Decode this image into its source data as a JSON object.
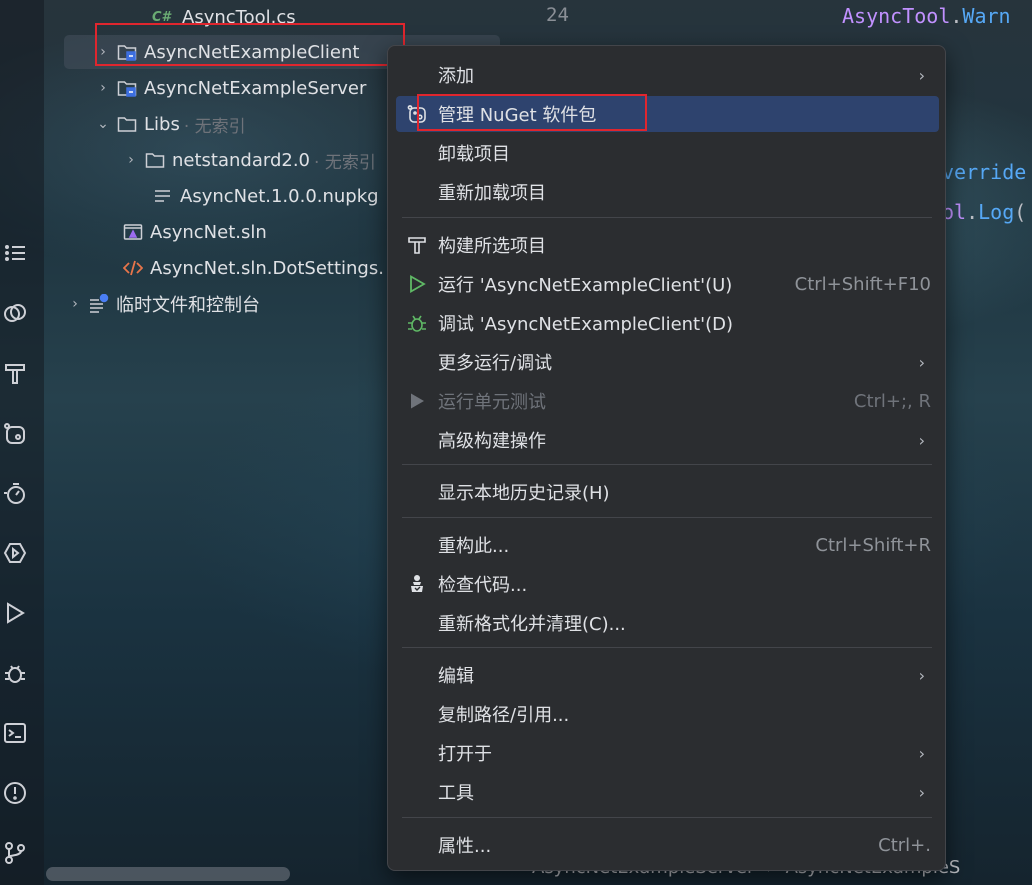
{
  "project_tree": {
    "items": [
      {
        "label": "AsyncTool.cs",
        "badge": "C#",
        "icon": "csharp-file-icon"
      },
      {
        "label": "AsyncNetExampleClient",
        "icon": "project-folder-icon",
        "expanded": false,
        "selected": true
      },
      {
        "label": "AsyncNetExampleServer",
        "icon": "project-folder-icon",
        "expanded": false
      },
      {
        "label": "Libs",
        "hint": "· 无索引",
        "icon": "folder-icon",
        "expanded": true
      },
      {
        "label": "netstandard2.0",
        "hint": "· 无索引",
        "icon": "folder-icon",
        "expanded": false
      },
      {
        "label": "AsyncNet.1.0.0.nupkg",
        "icon": "text-file-icon"
      },
      {
        "label": "AsyncNet.sln",
        "icon": "solution-file-icon"
      },
      {
        "label": "AsyncNet.sln.DotSettings.",
        "icon": "xml-file-icon"
      },
      {
        "label": "临时文件和控制台",
        "icon": "scratches-icon",
        "expanded": false
      }
    ]
  },
  "editor": {
    "line_number": "24",
    "code_line_1": {
      "type": "AsyncTool",
      "dot": ".",
      "method": "Warn"
    },
    "code_line_2": {
      "text": "verride"
    },
    "code_line_3": {
      "type": "ol",
      "dot": ".",
      "method": "Log",
      "paren": "("
    }
  },
  "status_bar": {
    "item1": "AsyncNetExampleServer",
    "sep": "›",
    "item2": "AsyncNetExampleS"
  },
  "context_menu": {
    "items": [
      {
        "label": "添加",
        "submenu": true
      },
      {
        "label": "管理 NuGet 软件包",
        "icon": "nuget-icon",
        "active": true
      },
      {
        "label": "卸载项目"
      },
      {
        "label": "重新加载项目"
      },
      {
        "label": "构建所选项目",
        "icon": "hammer-icon"
      },
      {
        "label": "运行 'AsyncNetExampleClient'(U)",
        "icon": "run-icon",
        "shortcut": "Ctrl+Shift+F10"
      },
      {
        "label": "调试 'AsyncNetExampleClient'(D)",
        "icon": "debug-icon"
      },
      {
        "label": "更多运行/调试",
        "submenu": true
      },
      {
        "label": "运行单元测试",
        "icon": "run-tests-icon",
        "shortcut": "Ctrl+;, R",
        "disabled": true
      },
      {
        "label": "高级构建操作",
        "submenu": true
      },
      {
        "label": "显示本地历史记录(H)"
      },
      {
        "label": "重构此...",
        "shortcut": "Ctrl+Shift+R"
      },
      {
        "label": "检查代码...",
        "icon": "inspect-icon"
      },
      {
        "label": "重新格式化并清理(C)..."
      },
      {
        "label": "编辑",
        "submenu": true
      },
      {
        "label": "复制路径/引用..."
      },
      {
        "label": "打开于",
        "submenu": true
      },
      {
        "label": "工具",
        "submenu": true
      },
      {
        "label": "属性...",
        "shortcut": "Ctrl+."
      }
    ],
    "submenu_arrow": "›"
  },
  "colors": {
    "highlight_box": "#e0262e",
    "menu_active": "#2e436e",
    "run_green": "#5fb865"
  }
}
